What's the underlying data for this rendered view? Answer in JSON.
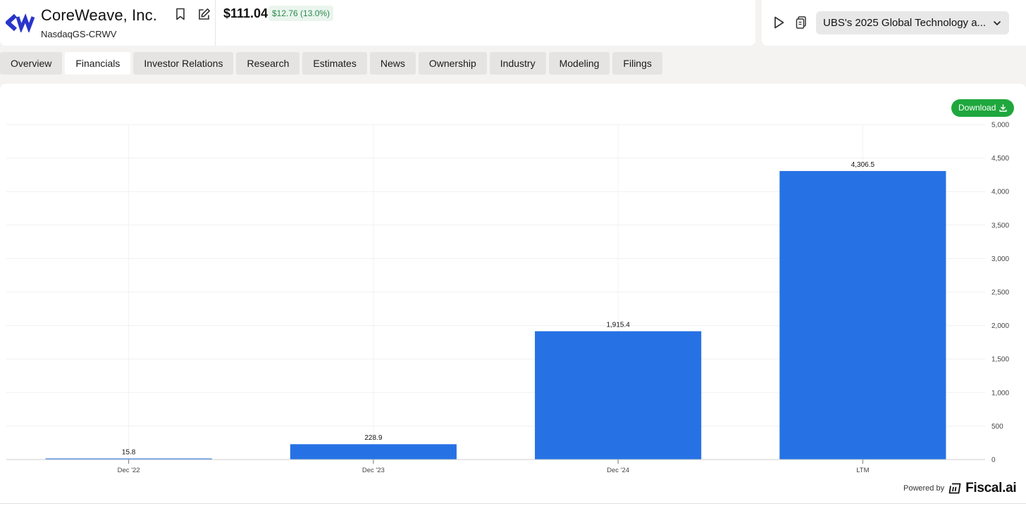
{
  "header": {
    "company_name": "CoreWeave, Inc.",
    "ticker": "NasdaqGS-CRWV",
    "price": "$111.04",
    "change": "$12.76 (13.0%)",
    "event_selector": "UBS's 2025 Global Technology a..."
  },
  "tabs": [
    {
      "label": "Overview",
      "active": false
    },
    {
      "label": "Financials",
      "active": true
    },
    {
      "label": "Investor Relations",
      "active": false
    },
    {
      "label": "Research",
      "active": false
    },
    {
      "label": "Estimates",
      "active": false
    },
    {
      "label": "News",
      "active": false
    },
    {
      "label": "Ownership",
      "active": false
    },
    {
      "label": "Industry",
      "active": false
    },
    {
      "label": "Modeling",
      "active": false
    },
    {
      "label": "Filings",
      "active": false
    }
  ],
  "download_label": "Download",
  "footer": {
    "powered_by": "Powered by",
    "brand": "Fiscal.ai"
  },
  "colors": {
    "bar": "#2672e4",
    "accent_green": "#1fa73d",
    "change_text": "#2c8a4e"
  },
  "icons": {
    "bookmark": "bookmark-icon",
    "edit": "edit-icon",
    "play": "play-icon",
    "document": "document-icon",
    "chevron": "chevron-down-icon",
    "download": "download-icon"
  },
  "chart_data": {
    "type": "bar",
    "categories": [
      "Dec '22",
      "Dec '23",
      "Dec '24",
      "LTM"
    ],
    "values": [
      15.8,
      228.9,
      1915.4,
      4306.5
    ],
    "value_labels": [
      "15.8",
      "228.9",
      "1,915.4",
      "4,306.5"
    ],
    "y_ticks": [
      "0",
      "500",
      "1,000",
      "1,500",
      "2,000",
      "2,500",
      "3,000",
      "3,500",
      "4,000",
      "4,500",
      "5,000"
    ],
    "ylim": [
      0,
      5000
    ],
    "y_axis_position": "right",
    "grid": true
  }
}
